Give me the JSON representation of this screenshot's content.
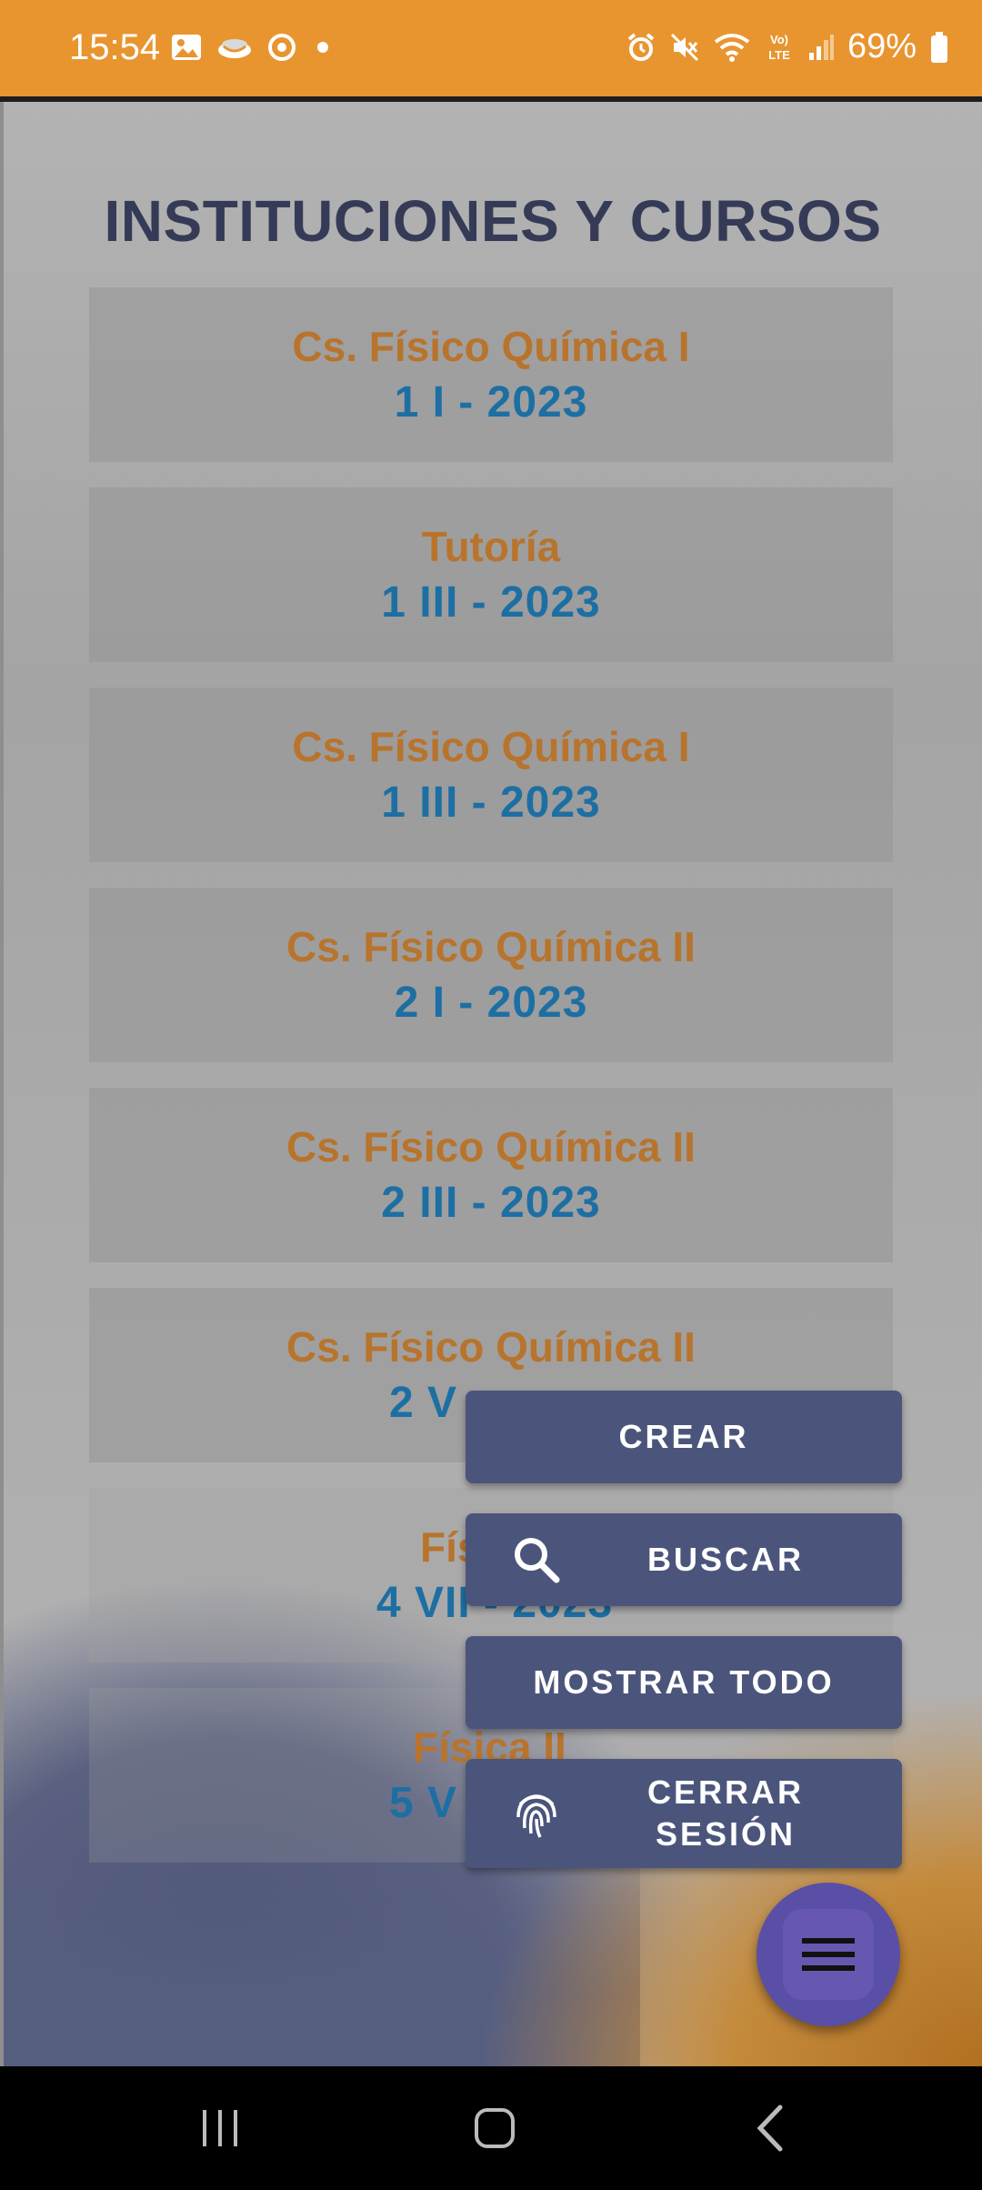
{
  "status_bar": {
    "time": "15:54",
    "battery": "69%",
    "left_icons": [
      "gallery-icon",
      "app-icon",
      "sync-icon",
      "dot-icon"
    ],
    "right_icons": [
      "alarm-icon",
      "mute-icon",
      "wifi-icon",
      "volte-icon",
      "signal-icon",
      "battery-icon"
    ]
  },
  "page": {
    "title": "INSTITUCIONES Y CURSOS"
  },
  "courses": [
    {
      "subject": "Cs. Físico Química I",
      "group": "1 I - 2023"
    },
    {
      "subject": "Tutoría",
      "group": "1 III - 2023"
    },
    {
      "subject": "Cs. Físico Química I",
      "group": "1 III - 2023"
    },
    {
      "subject": "Cs. Físico Química II",
      "group": "2 I - 2023"
    },
    {
      "subject": "Cs. Físico Química II",
      "group": "2 III - 2023"
    },
    {
      "subject": "Cs. Físico Química II",
      "group": "2 V"
    },
    {
      "subject": "Fís",
      "group": "4 VII - 2023"
    },
    {
      "subject": "Física II",
      "group": "5 V"
    }
  ],
  "fab_menu": {
    "crear": "CREAR",
    "buscar": "BUSCAR",
    "mostrar_todo": "MOSTRAR TODO",
    "cerrar_sesion_line1": "CERRAR",
    "cerrar_sesion_line2": "SESIÓN"
  },
  "colors": {
    "status_bar": "#e89530",
    "title": "#353b57",
    "subject": "#b8742c",
    "group": "#1d6fa3",
    "menu_button": "#4b557c",
    "fab": "#5a4fa6"
  }
}
